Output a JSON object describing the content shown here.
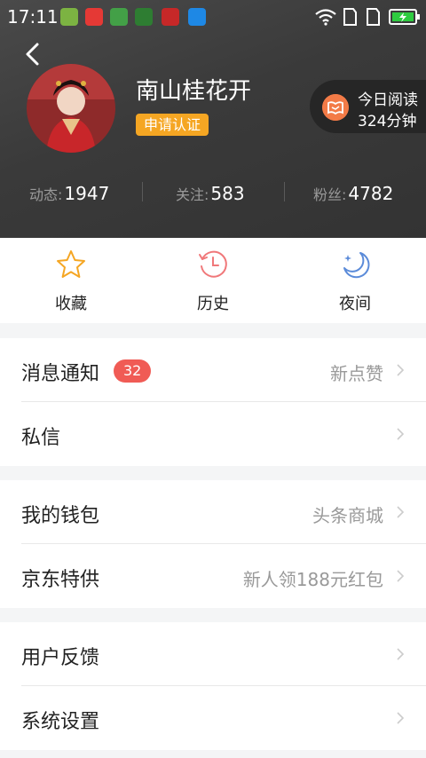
{
  "status_bar": {
    "time": "17:11"
  },
  "profile": {
    "name": "南山桂花开",
    "certify_label": "申请认证"
  },
  "reading": {
    "line1": "今日阅读",
    "line2": "324分钟"
  },
  "stats": [
    {
      "label": "动态:",
      "value": "1947"
    },
    {
      "label": "关注:",
      "value": "583"
    },
    {
      "label": "粉丝:",
      "value": "4782"
    }
  ],
  "quick_actions": [
    {
      "label": "收藏",
      "icon": "star-icon"
    },
    {
      "label": "历史",
      "icon": "history-clock-icon"
    },
    {
      "label": "夜间",
      "icon": "moon-icon"
    }
  ],
  "menu": {
    "notifications": {
      "label": "消息通知",
      "badge": "32",
      "hint": "新点赞"
    },
    "messages": {
      "label": "私信"
    },
    "wallet": {
      "label": "我的钱包",
      "hint": "头条商城"
    },
    "jd": {
      "label": "京东特供",
      "hint": "新人领188元红包"
    },
    "feedback": {
      "label": "用户反馈"
    },
    "settings": {
      "label": "系统设置"
    }
  },
  "colors": {
    "accent_orange": "#f5a623",
    "badge_red": "#f05b55",
    "header_bg": "#3c3c3c"
  }
}
